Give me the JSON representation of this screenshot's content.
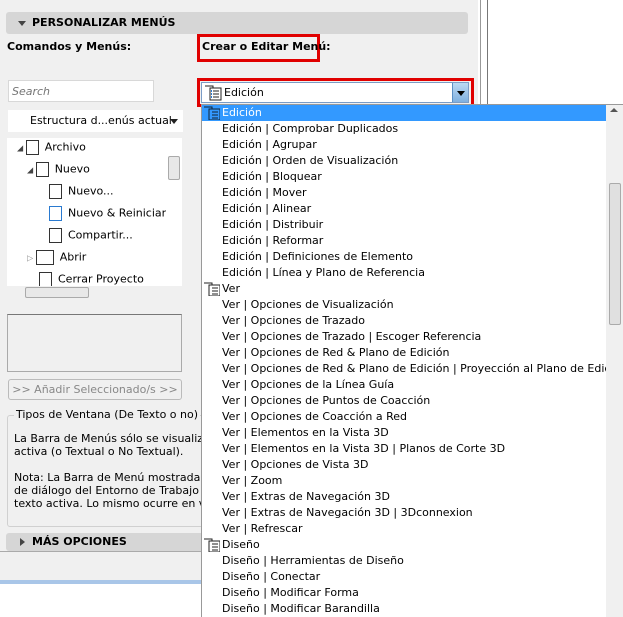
{
  "section_title": "PERSONALIZAR MENÚS",
  "commands_label": "Comandos y Menús:",
  "create_label": "Crear o Editar Menú:",
  "search_placeholder": "Search",
  "structure_select": "Estructura d...enús actual",
  "tree": [
    {
      "label": "Archivo",
      "icon": "menu-list-icon"
    },
    {
      "label": "Nuevo",
      "icon": "document-icon"
    },
    {
      "label": "Nuevo...",
      "icon": "document-icon"
    },
    {
      "label": "Nuevo & Reiniciar",
      "icon": "document-reset-icon"
    },
    {
      "label": "Compartir...",
      "icon": "share-house-icon"
    },
    {
      "label": "Abrir",
      "icon": "open-folder-icon"
    },
    {
      "label": "Cerrar Proyecto",
      "icon": "close-document-icon"
    }
  ],
  "add_button": ">> Añadir Seleccionado/s >>",
  "window_types": {
    "legend": "Tipos de Ventana (De Texto o no)",
    "lines": [
      "La Barra de Menús sólo se visualizará",
      "activa (o Textual o No Textual).",
      "",
      "Nota: La Barra de Menú mostrada en",
      "de diálogo del Entorno de Trabajo e",
      "texto activa. Lo mismo ocurre en vent"
    ]
  },
  "more_options": "MÁS OPCIONES",
  "menu_select_value": "Edición",
  "accent": "#3399ff",
  "dropdown_items": [
    {
      "label": "Edición",
      "group": true,
      "selected": true
    },
    {
      "label": "Edición | Comprobar Duplicados"
    },
    {
      "label": "Edición | Agrupar"
    },
    {
      "label": "Edición | Orden de Visualización"
    },
    {
      "label": "Edición | Bloquear"
    },
    {
      "label": "Edición | Mover"
    },
    {
      "label": "Edición | Alinear"
    },
    {
      "label": "Edición | Distribuir"
    },
    {
      "label": "Edición | Reformar"
    },
    {
      "label": "Edición | Definiciones de Elemento"
    },
    {
      "label": "Edición | Línea y Plano de Referencia"
    },
    {
      "label": "Ver",
      "group": true
    },
    {
      "label": "Ver | Opciones de Visualización"
    },
    {
      "label": "Ver | Opciones de Trazado"
    },
    {
      "label": "Ver | Opciones de Trazado | Escoger Referencia"
    },
    {
      "label": "Ver | Opciones de Red & Plano de Edición"
    },
    {
      "label": "Ver | Opciones de Red & Plano de Edición | Proyección al Plano de Edición"
    },
    {
      "label": "Ver | Opciones de la Línea Guía"
    },
    {
      "label": "Ver | Opciones de Puntos de Coacción"
    },
    {
      "label": "Ver | Opciones de Coacción a Red"
    },
    {
      "label": "Ver | Elementos en la Vista 3D"
    },
    {
      "label": "Ver | Elementos en la Vista 3D | Planos de Corte 3D"
    },
    {
      "label": "Ver | Opciones de Vista 3D"
    },
    {
      "label": "Ver | Zoom"
    },
    {
      "label": "Ver | Extras de Navegación 3D"
    },
    {
      "label": "Ver | Extras de Navegación 3D | 3Dconnexion"
    },
    {
      "label": "Ver | Refrescar"
    },
    {
      "label": "Diseño",
      "group": true
    },
    {
      "label": "Diseño | Herramientas de Diseño"
    },
    {
      "label": "Diseño | Conectar"
    },
    {
      "label": "Diseño | Modificar Forma"
    },
    {
      "label": "Diseño | Modificar Barandilla"
    }
  ]
}
